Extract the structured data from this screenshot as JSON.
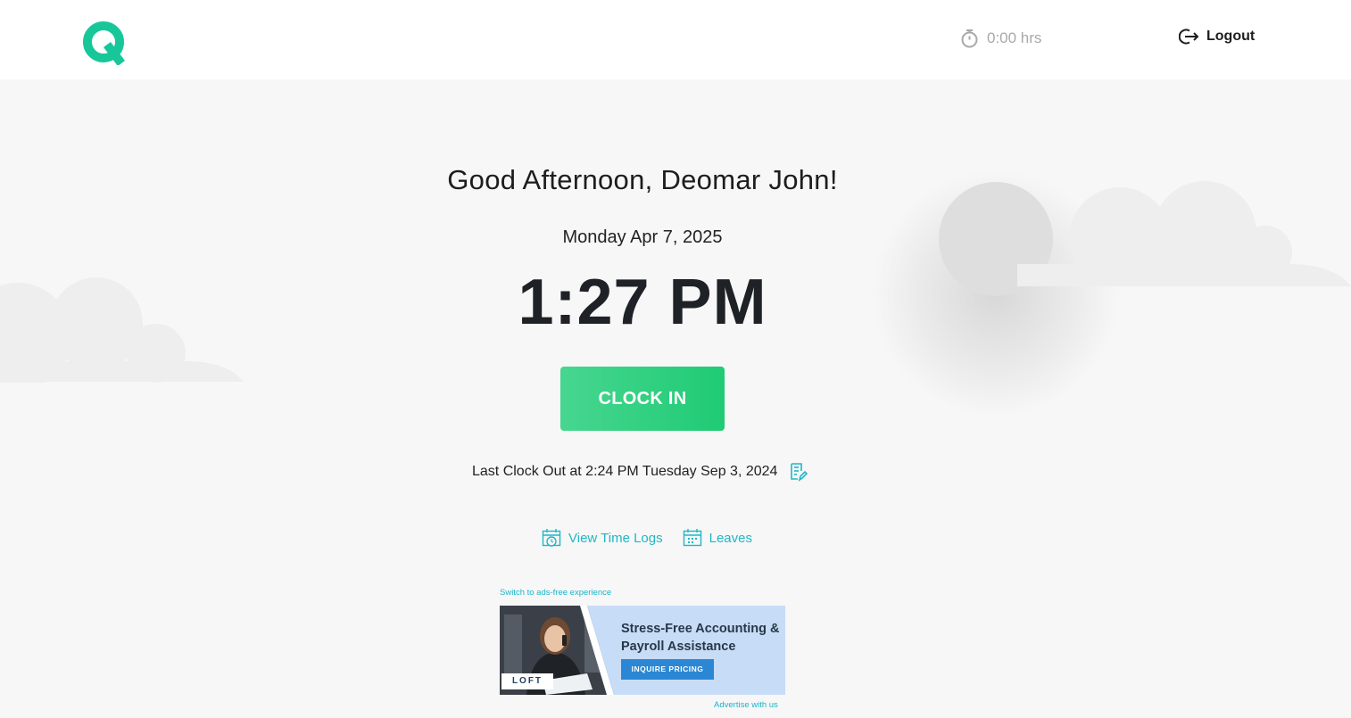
{
  "header": {
    "timer": "0:00 hrs",
    "logout_label": "Logout"
  },
  "main": {
    "greeting": "Good Afternoon, Deomar John!",
    "date": "Monday Apr 7, 2025",
    "time": "1:27 PM",
    "clock_in_label": "CLOCK IN",
    "last_clock_out": "Last Clock Out at 2:24 PM Tuesday Sep 3, 2024"
  },
  "links": {
    "time_logs": "View Time Logs",
    "leaves": "Leaves"
  },
  "ad": {
    "switch_label": "Switch to ads-free experience",
    "headline": "Stress-Free Accounting & Payroll Assistance",
    "cta": "INQUIRE PRICING",
    "brand": "LOFT",
    "advertise_label": "Advertise with us"
  },
  "colors": {
    "accent": "#1fb8c4",
    "brand": "#17c79a",
    "button": "#2ccf7e",
    "background": "#f7f7f7"
  },
  "icons": [
    "app-logo",
    "stopwatch-icon",
    "logout-icon",
    "edit-note-icon",
    "calendar-clock-icon",
    "calendar-icon",
    "sun",
    "cloud"
  ]
}
